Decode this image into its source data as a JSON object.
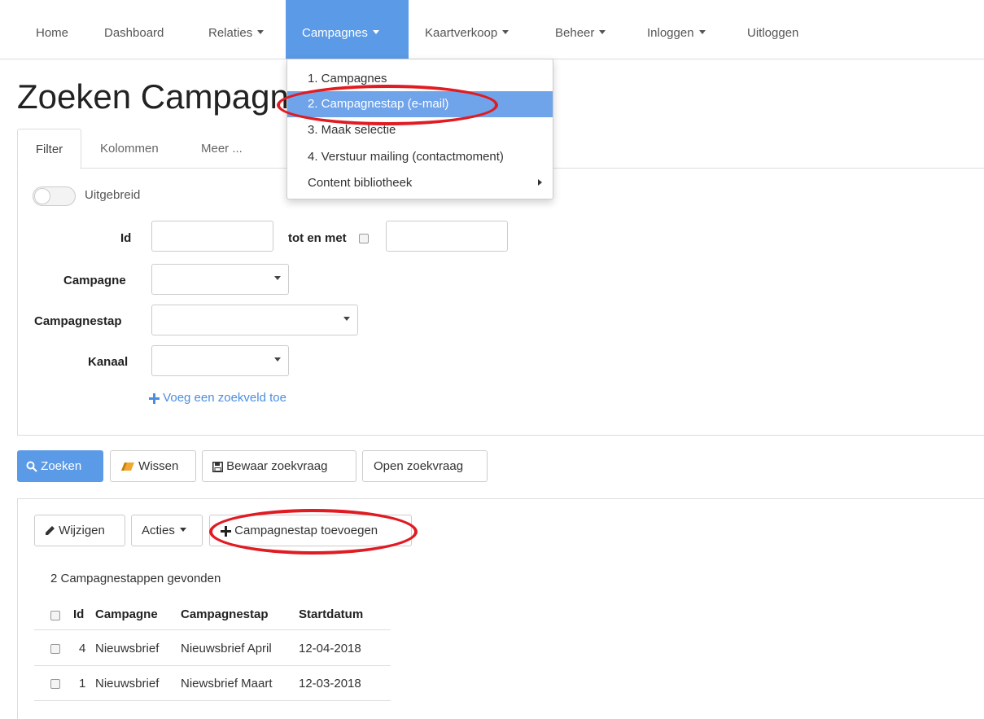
{
  "nav": {
    "items": [
      {
        "label": "Home"
      },
      {
        "label": "Dashboard"
      },
      {
        "label": "Relaties"
      },
      {
        "label": "Campagnes"
      },
      {
        "label": "Kaartverkoop"
      },
      {
        "label": "Beheer"
      },
      {
        "label": "Inloggen"
      },
      {
        "label": "Uitloggen"
      }
    ],
    "active_index": 3
  },
  "dropdown": {
    "items": [
      {
        "label": "1. Campagnes"
      },
      {
        "label": "2. Campagnestap (e-mail)"
      },
      {
        "label": "3. Maak selectie"
      },
      {
        "label": "4. Verstuur mailing (contactmoment)"
      },
      {
        "label": "Content bibliotheek"
      }
    ],
    "active_index": 1
  },
  "page": {
    "title": "Zoeken Campagnestappen"
  },
  "tabs": [
    {
      "label": "Filter"
    },
    {
      "label": "Kolommen"
    },
    {
      "label": "Meer ..."
    }
  ],
  "filter": {
    "toggle_label": "Uitgebreid",
    "id_label": "Id",
    "id_value": "",
    "range_label": "tot en met",
    "range_value": "",
    "campagne_label": "Campagne",
    "campagnestap_label": "Campagnestap",
    "kanaal_label": "Kanaal",
    "add_field_link": "Voeg een zoekveld toe"
  },
  "search_buttons": {
    "zoeken": "Zoeken",
    "wissen": "Wissen",
    "bewaar": "Bewaar zoekvraag",
    "open": "Open zoekvraag"
  },
  "results": {
    "wijzigen": "Wijzigen",
    "acties": "Acties",
    "toevoegen": "Campagnestap toevoegen",
    "count_text": "2 Campagnestappen gevonden",
    "columns": [
      "Id",
      "Campagne",
      "Campagnestap",
      "Startdatum"
    ],
    "rows": [
      {
        "id": "4",
        "campagne": "Nieuwsbrief",
        "campagnestap": "Nieuwsbrief April",
        "startdatum": "12-04-2018"
      },
      {
        "id": "1",
        "campagne": "Nieuwsbrief",
        "campagnestap": "Niewsbrief Maart",
        "startdatum": "12-03-2018"
      }
    ]
  },
  "colors": {
    "primary": "#5b9ae6",
    "highlight": "#e01b22"
  }
}
